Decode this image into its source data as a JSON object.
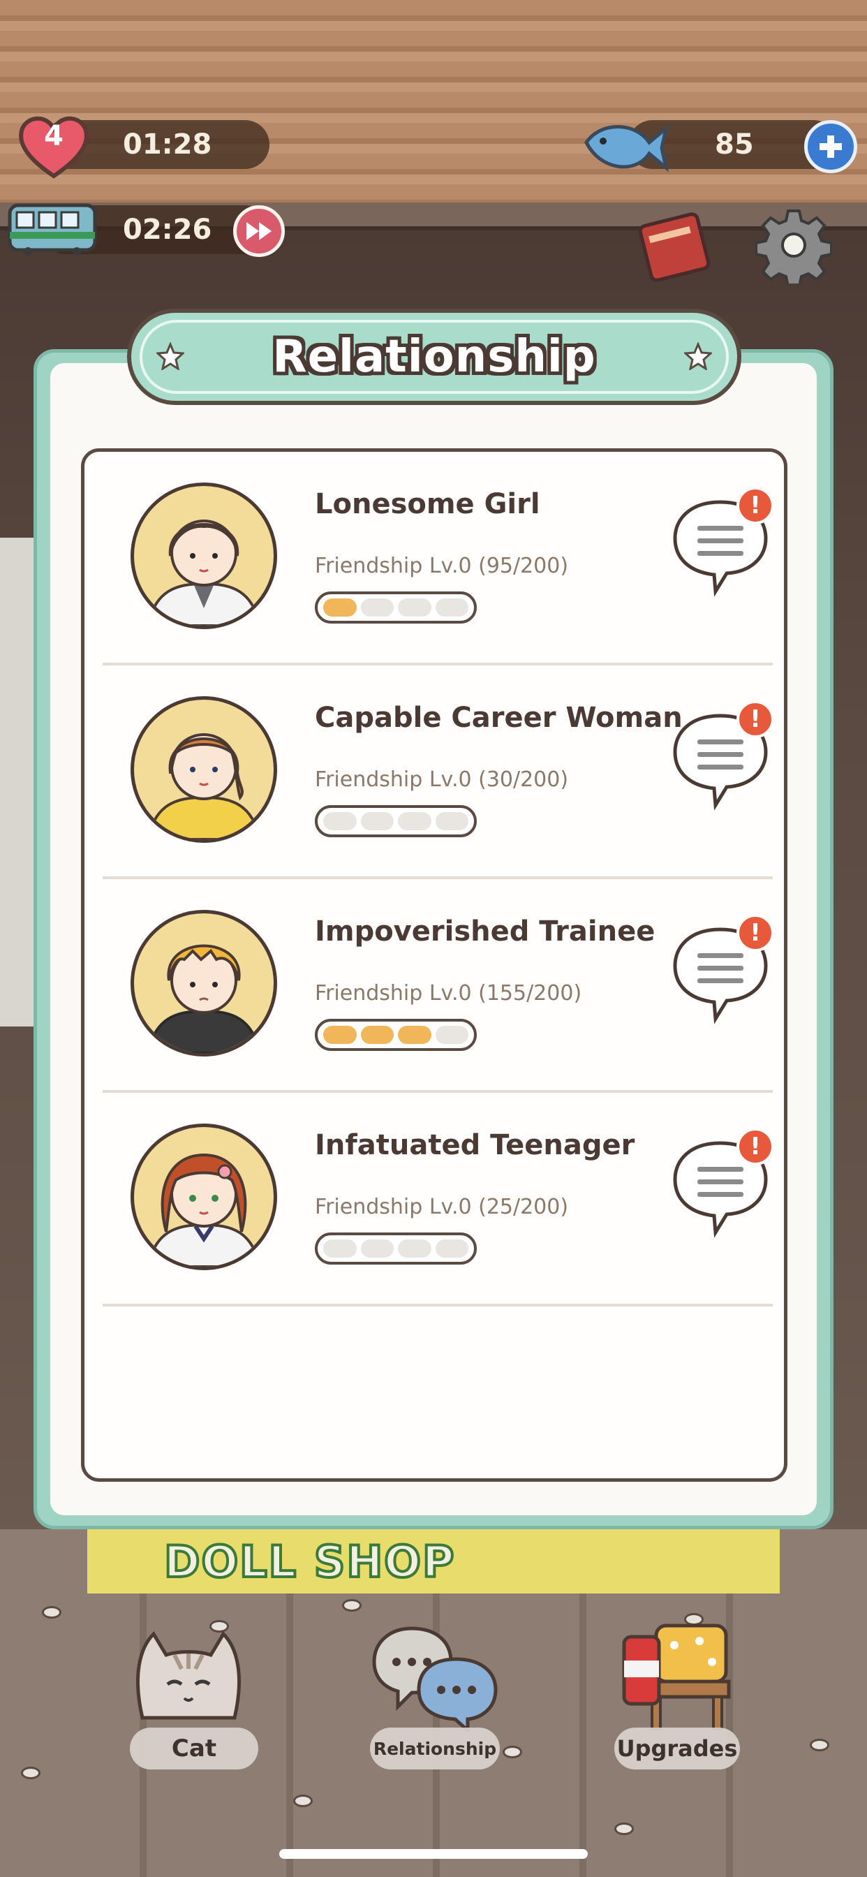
{
  "hud": {
    "hearts": "4",
    "heart_timer": "01:28",
    "train_timer": "02:26",
    "fish_count": "85"
  },
  "modal": {
    "title": "Relationship",
    "characters": [
      {
        "name": "Lonesome Girl",
        "friendship": "Friendship Lv.0 (95/200)",
        "progress": 0.475,
        "hair": "#8a5a3a",
        "alert": "!"
      },
      {
        "name": "Capable Career Woman",
        "friendship": "Friendship Lv.0 (30/200)",
        "progress": 0.15,
        "hair": "#d9803a",
        "alert": "!"
      },
      {
        "name": "Impoverished Trainee",
        "friendship": "Friendship Lv.0 (155/200)",
        "progress": 0.775,
        "hair": "#f2b63a",
        "alert": "!"
      },
      {
        "name": "Infatuated Teenager",
        "friendship": "Friendship Lv.0 (25/200)",
        "progress": 0.125,
        "hair": "#c0502a",
        "alert": "!"
      }
    ]
  },
  "banner": {
    "text": "DOLL SHOP"
  },
  "nav": {
    "cat": "Cat",
    "relationship": "Relationship",
    "upgrades": "Upgrades"
  },
  "icons": {
    "heart": "heart-icon",
    "train": "train-icon",
    "fast_forward": "fast-forward-icon",
    "fish": "fish-icon",
    "plus": "plus-icon",
    "book": "book-icon",
    "gear": "gear-icon",
    "chat": "chat-bubble-icon",
    "cat": "cat-icon",
    "relationship": "speech-bubbles-icon",
    "upgrades": "furniture-icon"
  },
  "colors": {
    "modal_frame": "#9fd3c4",
    "alert": "#e8583a",
    "plus": "#3a7ad0",
    "fast_forward": "#d95a6a"
  }
}
